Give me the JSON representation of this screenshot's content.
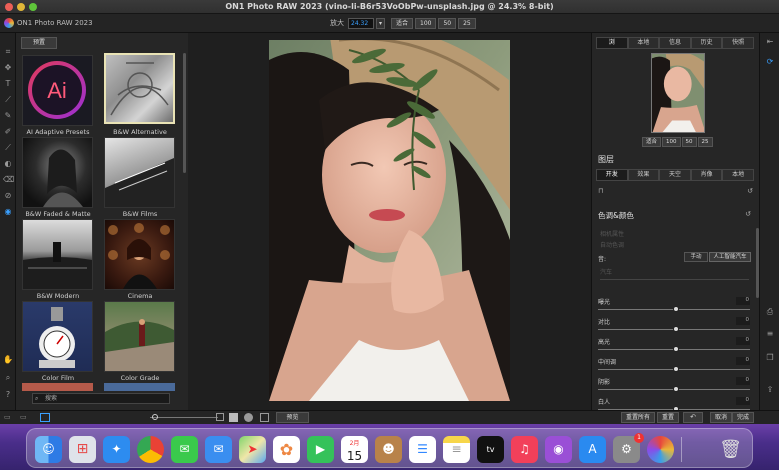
{
  "window": {
    "title": "ON1 Photo RAW 2023 (vino-li-B6r53VoObPw-unsplash.jpg @ 24.3% 8-bit)"
  },
  "app": {
    "name": "ON1 Photo RAW 2023"
  },
  "zoom": {
    "label": "放大",
    "value": "24.32",
    "dropdown": "▾",
    "fit": "适合",
    "z100": "100",
    "z50": "50",
    "z25": "25"
  },
  "presets": {
    "tab": "预置",
    "items": [
      {
        "label": "AI Adaptive Presets"
      },
      {
        "label": "B&W Alternative"
      },
      {
        "label": "B&W Faded & Matte"
      },
      {
        "label": "B&W Films"
      },
      {
        "label": "B&W Modern"
      },
      {
        "label": "Cinema"
      },
      {
        "label": "Color Film"
      },
      {
        "label": "Color Grade"
      }
    ],
    "search_placeholder": "搜索"
  },
  "right": {
    "tabs": [
      "浏",
      "本地",
      "信息",
      "历史",
      "快照"
    ],
    "nav_zoom": [
      "适合",
      "100",
      "50",
      "25"
    ],
    "layers_title": "图层",
    "layer_tabs": [
      "开发",
      "效果",
      "天空",
      "肖像",
      "本地"
    ],
    "sub_label": "色调&颜色",
    "faded1": "相机属性",
    "faded2": "自动色调",
    "mode_label": "音:",
    "mode_btn1": "手动",
    "mode_btn2": "人工智能汽车",
    "faded3": "汽车",
    "sliders": [
      {
        "label": "曝光",
        "value": "0",
        "pos": 0.5
      },
      {
        "label": "对比",
        "value": "0",
        "pos": 0.5
      },
      {
        "label": "高光",
        "value": "0",
        "pos": 0.5
      },
      {
        "label": "中间调",
        "value": "0",
        "pos": 0.5
      },
      {
        "label": "阴影",
        "value": "0",
        "pos": 0.5
      },
      {
        "label": "白人",
        "value": "0",
        "pos": 0.5
      }
    ]
  },
  "bottom": {
    "preview": "预览",
    "reset_all": "重置所有",
    "reset": "重置",
    "cancel": "取消",
    "done": "完成"
  },
  "dock": {
    "calendar_month": "2月",
    "calendar_day": "15",
    "badge": "1",
    "tv": "tv"
  }
}
